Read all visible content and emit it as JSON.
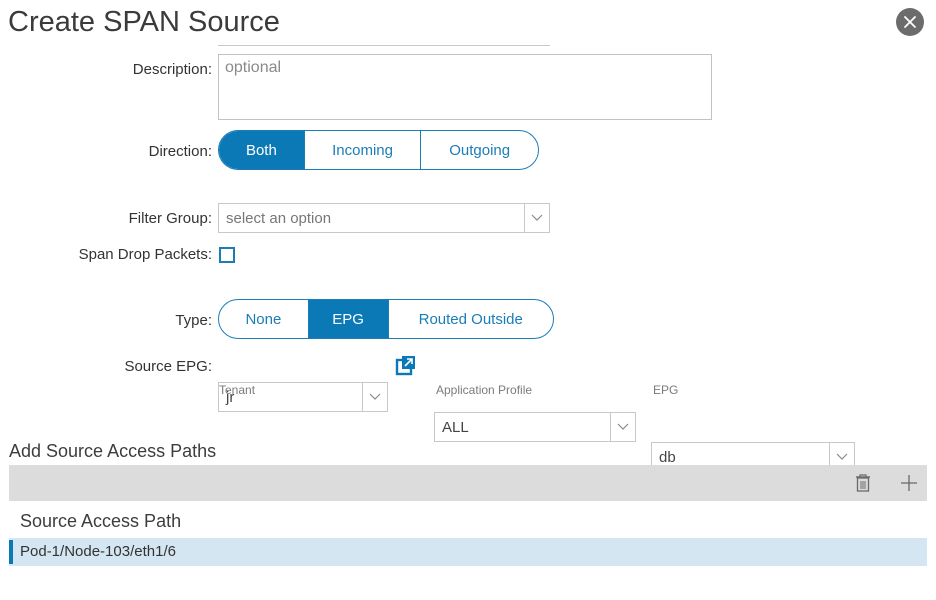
{
  "dialog": {
    "title": "Create SPAN Source"
  },
  "form": {
    "description_label": "Description:",
    "description_placeholder": "optional",
    "direction_label": "Direction:",
    "direction_options": [
      "Both",
      "Incoming",
      "Outgoing"
    ],
    "direction_selected": "Both",
    "filter_group_label": "Filter Group:",
    "filter_group_placeholder": "select an option",
    "span_drop_label": "Span Drop Packets:",
    "span_drop_checked": false,
    "type_label": "Type:",
    "type_options": [
      "None",
      "EPG",
      "Routed Outside"
    ],
    "type_selected": "EPG",
    "source_epg_label": "Source EPG:",
    "tenant_value": "jr",
    "tenant_caption": "Tenant",
    "app_profile_value": "ALL",
    "app_profile_caption": "Application Profile",
    "epg_value": "db",
    "epg_caption": "EPG"
  },
  "access_paths": {
    "section_title": "Add Source Access Paths",
    "column_header": "Source Access Path",
    "rows": [
      "Pod-1/Node-103/eth1/6"
    ]
  },
  "colors": {
    "accent": "#0b79b5",
    "selected_row": "#d4e6f1",
    "toolbar": "#dcdcdc"
  },
  "icons": [
    "close-icon",
    "chevron-down-icon",
    "open-external-icon",
    "trash-icon",
    "plus-icon"
  ]
}
